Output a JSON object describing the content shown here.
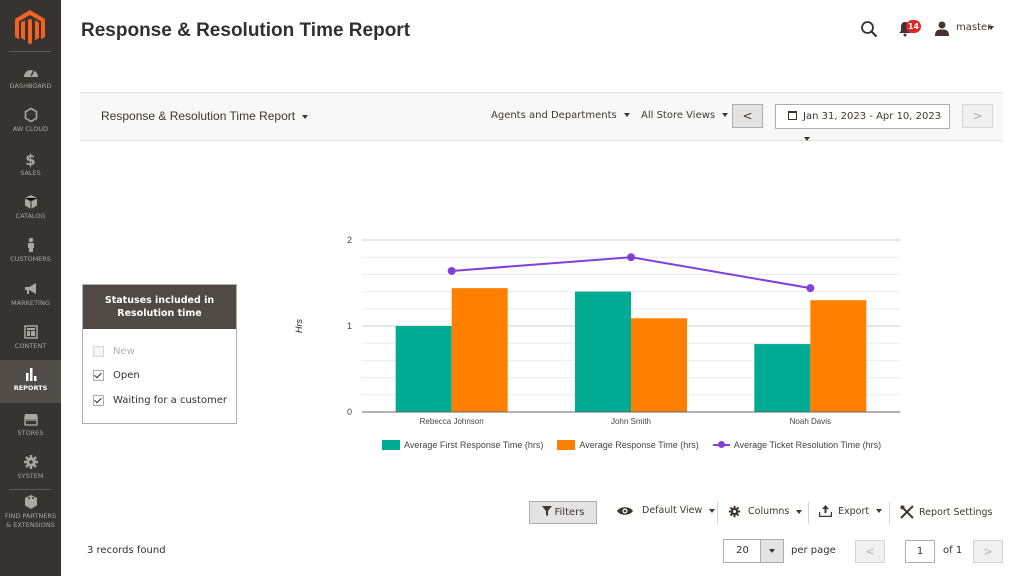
{
  "sidebar": {
    "logo": "magento-logo",
    "items": [
      {
        "label": "DASHBOARD",
        "icon": "dashboard-icon",
        "active": false
      },
      {
        "label": "AW CLOUD",
        "icon": "hexagon-icon",
        "active": false
      },
      {
        "label": "SALES",
        "icon": "dollar-icon",
        "active": false
      },
      {
        "label": "CATALOG",
        "icon": "box-icon",
        "active": false
      },
      {
        "label": "CUSTOMERS",
        "icon": "person-icon",
        "active": false
      },
      {
        "label": "MARKETING",
        "icon": "megaphone-icon",
        "active": false
      },
      {
        "label": "CONTENT",
        "icon": "layout-icon",
        "active": false
      },
      {
        "label": "REPORTS",
        "icon": "bar-chart-icon",
        "active": true
      },
      {
        "label": "STORES",
        "icon": "storefront-icon",
        "active": false
      },
      {
        "label": "SYSTEM",
        "icon": "gear-icon",
        "active": false
      },
      {
        "label": "FIND PARTNERS & EXTENSIONS",
        "icon": "blocks-icon",
        "active": false
      }
    ]
  },
  "header": {
    "title": "Response & Resolution Time Report",
    "notifications_count": "14",
    "user_name": "master"
  },
  "toolbar": {
    "report_select": "Response & Resolution Time Report",
    "agents_select": "Agents and Departments",
    "store_select": "All Store Views",
    "prev_label": "<",
    "date_range": "Jan 31, 2023 - Apr 10, 2023",
    "next_label": ">"
  },
  "statuses": {
    "title": "Statuses included in Resolution time",
    "items": [
      {
        "label": "New",
        "checked": false,
        "disabled": true
      },
      {
        "label": "Open",
        "checked": true,
        "disabled": false
      },
      {
        "label": "Waiting for a customer",
        "checked": true,
        "disabled": false
      }
    ]
  },
  "colors": {
    "teal": "#00ab94",
    "orange": "#ff7f00",
    "purple": "#8040dc",
    "sidebar_bg": "#373330"
  },
  "chart_data": {
    "type": "bar",
    "title": "",
    "xlabel": "",
    "ylabel": "Hrs",
    "ylim": [
      0,
      2
    ],
    "yticks": [
      "0",
      "1",
      "2"
    ],
    "grid": true,
    "legend_position": "bottom",
    "categories": [
      "Rebecca Johnson",
      "John Smith",
      "Noah Davis"
    ],
    "series": [
      {
        "name": "Average First Response Time (hrs)",
        "kind": "bar",
        "color": "#00ab94",
        "values": [
          1.0,
          1.4,
          0.79
        ]
      },
      {
        "name": "Average Response Time (hrs)",
        "kind": "bar",
        "color": "#ff7f00",
        "values": [
          1.44,
          1.09,
          1.3
        ]
      },
      {
        "name": "Average Ticket Resolution Time (hrs)",
        "kind": "line",
        "color": "#8040dc",
        "values": [
          1.64,
          1.8,
          1.44
        ]
      }
    ]
  },
  "grid_tools": {
    "filters": "Filters",
    "view": "Default View",
    "columns": "Columns",
    "export": "Export",
    "settings": "Report Settings"
  },
  "footer": {
    "records": "3 records found",
    "per_page_value": "20",
    "per_page_label": "per page",
    "current_page": "1",
    "of_pages": "of 1",
    "prev_label": "<",
    "next_label": ">"
  }
}
